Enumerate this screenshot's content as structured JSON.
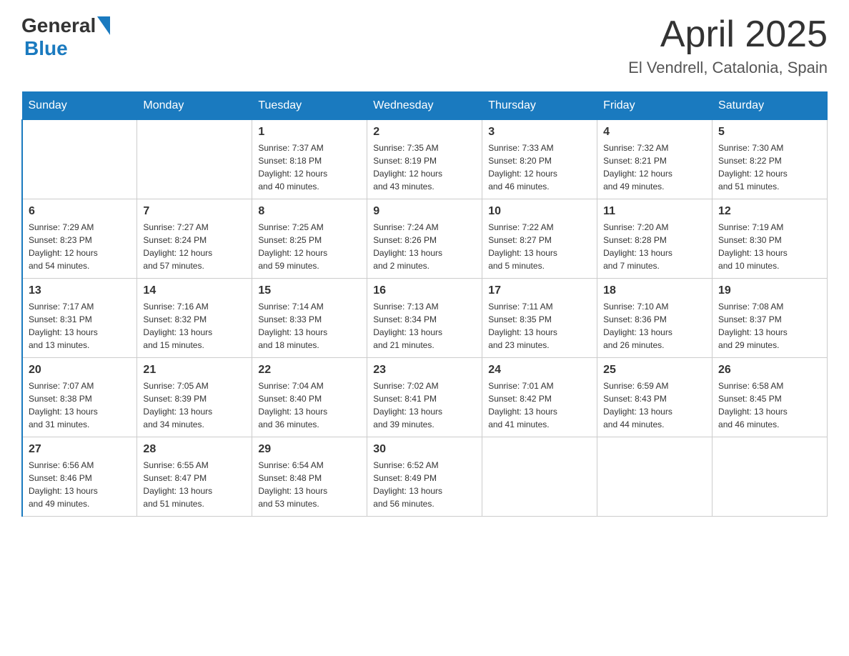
{
  "header": {
    "logo_general": "General",
    "logo_blue": "Blue",
    "title": "April 2025",
    "subtitle": "El Vendrell, Catalonia, Spain"
  },
  "weekdays": [
    "Sunday",
    "Monday",
    "Tuesday",
    "Wednesday",
    "Thursday",
    "Friday",
    "Saturday"
  ],
  "weeks": [
    [
      {
        "day": "",
        "info": ""
      },
      {
        "day": "",
        "info": ""
      },
      {
        "day": "1",
        "info": "Sunrise: 7:37 AM\nSunset: 8:18 PM\nDaylight: 12 hours\nand 40 minutes."
      },
      {
        "day": "2",
        "info": "Sunrise: 7:35 AM\nSunset: 8:19 PM\nDaylight: 12 hours\nand 43 minutes."
      },
      {
        "day": "3",
        "info": "Sunrise: 7:33 AM\nSunset: 8:20 PM\nDaylight: 12 hours\nand 46 minutes."
      },
      {
        "day": "4",
        "info": "Sunrise: 7:32 AM\nSunset: 8:21 PM\nDaylight: 12 hours\nand 49 minutes."
      },
      {
        "day": "5",
        "info": "Sunrise: 7:30 AM\nSunset: 8:22 PM\nDaylight: 12 hours\nand 51 minutes."
      }
    ],
    [
      {
        "day": "6",
        "info": "Sunrise: 7:29 AM\nSunset: 8:23 PM\nDaylight: 12 hours\nand 54 minutes."
      },
      {
        "day": "7",
        "info": "Sunrise: 7:27 AM\nSunset: 8:24 PM\nDaylight: 12 hours\nand 57 minutes."
      },
      {
        "day": "8",
        "info": "Sunrise: 7:25 AM\nSunset: 8:25 PM\nDaylight: 12 hours\nand 59 minutes."
      },
      {
        "day": "9",
        "info": "Sunrise: 7:24 AM\nSunset: 8:26 PM\nDaylight: 13 hours\nand 2 minutes."
      },
      {
        "day": "10",
        "info": "Sunrise: 7:22 AM\nSunset: 8:27 PM\nDaylight: 13 hours\nand 5 minutes."
      },
      {
        "day": "11",
        "info": "Sunrise: 7:20 AM\nSunset: 8:28 PM\nDaylight: 13 hours\nand 7 minutes."
      },
      {
        "day": "12",
        "info": "Sunrise: 7:19 AM\nSunset: 8:30 PM\nDaylight: 13 hours\nand 10 minutes."
      }
    ],
    [
      {
        "day": "13",
        "info": "Sunrise: 7:17 AM\nSunset: 8:31 PM\nDaylight: 13 hours\nand 13 minutes."
      },
      {
        "day": "14",
        "info": "Sunrise: 7:16 AM\nSunset: 8:32 PM\nDaylight: 13 hours\nand 15 minutes."
      },
      {
        "day": "15",
        "info": "Sunrise: 7:14 AM\nSunset: 8:33 PM\nDaylight: 13 hours\nand 18 minutes."
      },
      {
        "day": "16",
        "info": "Sunrise: 7:13 AM\nSunset: 8:34 PM\nDaylight: 13 hours\nand 21 minutes."
      },
      {
        "day": "17",
        "info": "Sunrise: 7:11 AM\nSunset: 8:35 PM\nDaylight: 13 hours\nand 23 minutes."
      },
      {
        "day": "18",
        "info": "Sunrise: 7:10 AM\nSunset: 8:36 PM\nDaylight: 13 hours\nand 26 minutes."
      },
      {
        "day": "19",
        "info": "Sunrise: 7:08 AM\nSunset: 8:37 PM\nDaylight: 13 hours\nand 29 minutes."
      }
    ],
    [
      {
        "day": "20",
        "info": "Sunrise: 7:07 AM\nSunset: 8:38 PM\nDaylight: 13 hours\nand 31 minutes."
      },
      {
        "day": "21",
        "info": "Sunrise: 7:05 AM\nSunset: 8:39 PM\nDaylight: 13 hours\nand 34 minutes."
      },
      {
        "day": "22",
        "info": "Sunrise: 7:04 AM\nSunset: 8:40 PM\nDaylight: 13 hours\nand 36 minutes."
      },
      {
        "day": "23",
        "info": "Sunrise: 7:02 AM\nSunset: 8:41 PM\nDaylight: 13 hours\nand 39 minutes."
      },
      {
        "day": "24",
        "info": "Sunrise: 7:01 AM\nSunset: 8:42 PM\nDaylight: 13 hours\nand 41 minutes."
      },
      {
        "day": "25",
        "info": "Sunrise: 6:59 AM\nSunset: 8:43 PM\nDaylight: 13 hours\nand 44 minutes."
      },
      {
        "day": "26",
        "info": "Sunrise: 6:58 AM\nSunset: 8:45 PM\nDaylight: 13 hours\nand 46 minutes."
      }
    ],
    [
      {
        "day": "27",
        "info": "Sunrise: 6:56 AM\nSunset: 8:46 PM\nDaylight: 13 hours\nand 49 minutes."
      },
      {
        "day": "28",
        "info": "Sunrise: 6:55 AM\nSunset: 8:47 PM\nDaylight: 13 hours\nand 51 minutes."
      },
      {
        "day": "29",
        "info": "Sunrise: 6:54 AM\nSunset: 8:48 PM\nDaylight: 13 hours\nand 53 minutes."
      },
      {
        "day": "30",
        "info": "Sunrise: 6:52 AM\nSunset: 8:49 PM\nDaylight: 13 hours\nand 56 minutes."
      },
      {
        "day": "",
        "info": ""
      },
      {
        "day": "",
        "info": ""
      },
      {
        "day": "",
        "info": ""
      }
    ]
  ]
}
